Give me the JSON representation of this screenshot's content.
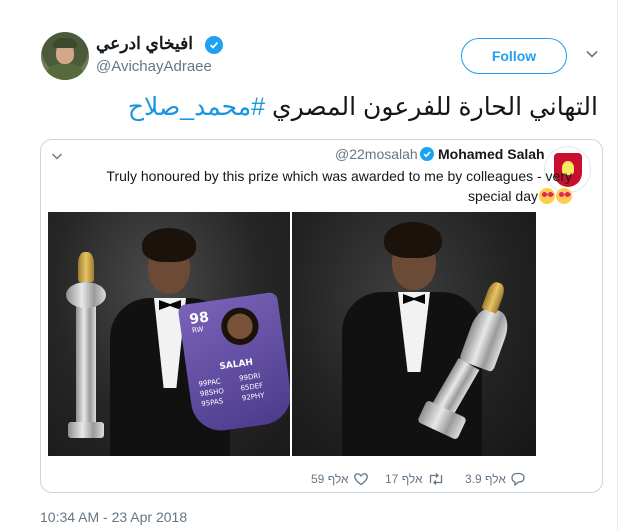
{
  "author": {
    "display_name": "افيخاي ادرعي",
    "handle": "@AvichayAdraee",
    "verified": true,
    "avatar_icon": "avatar-icon"
  },
  "follow_button": {
    "label": "Follow"
  },
  "tweet": {
    "text": "التهاني الحارة للفرعون المصري",
    "hashtag": "#محمد_صلاح"
  },
  "quoted_tweet": {
    "display_name": "Mohamed Salah",
    "handle": "@22mosalah",
    "verified": true,
    "text": "Truly honoured by this prize which was awarded to me by colleagues - very special day",
    "emoji": "heart-eyes-emoji",
    "fifa_card": {
      "rating": "98",
      "position": "RW",
      "name": "SALAH",
      "stats": [
        "99PAC",
        "99DRI",
        "98SHO",
        "65DEF",
        "95PAS",
        "92PHY"
      ]
    }
  },
  "actions": {
    "replies": "3.9 אלף",
    "retweets": "17 אלף",
    "likes": "59 אלף"
  },
  "timestamp": "10:34 AM - 23 Apr 2018",
  "colors": {
    "accent": "#1da1f2",
    "hashtag": "#1b95e0",
    "muted": "#657786",
    "border": "#ccd6dd"
  }
}
